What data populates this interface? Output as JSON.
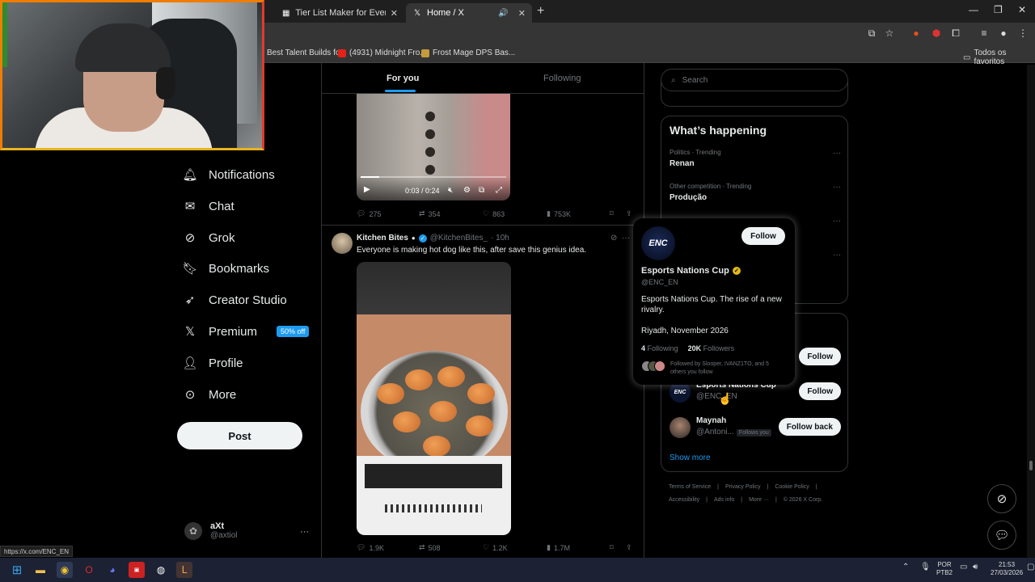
{
  "browser": {
    "tabs": [
      {
        "title": "Tier List Maker for Everything -",
        "icon": "tierlist-icon"
      },
      {
        "title": "Home / X",
        "icon": "x-logo-icon",
        "active": true
      }
    ],
    "bookmarks": [
      {
        "label": "Best Talent Builds fo...",
        "color": "#2a2a2a"
      },
      {
        "label": "(4931) Midnight Fro...",
        "color": "#e62117"
      },
      {
        "label": "Frost Mage DPS Bas...",
        "color": "#c49a3a"
      }
    ],
    "bookmarks_all": "Todos os favoritos",
    "status_url": "https://x.com/ENC_EN"
  },
  "nav": {
    "items": [
      {
        "label": "Notifications",
        "icon": "bell-icon"
      },
      {
        "label": "Chat",
        "icon": "mail-icon"
      },
      {
        "label": "Grok",
        "icon": "grok-icon"
      },
      {
        "label": "Bookmarks",
        "icon": "bookmark-icon"
      },
      {
        "label": "Creator Studio",
        "icon": "rocket-icon"
      },
      {
        "label": "Premium",
        "icon": "x-logo-icon",
        "badge": "50% off"
      },
      {
        "label": "Profile",
        "icon": "person-icon"
      },
      {
        "label": "More",
        "icon": "more-circle-icon"
      }
    ],
    "post_label": "Post",
    "account": {
      "name": "aXt",
      "handle": "@axtiol"
    }
  },
  "timeline": {
    "tabs": [
      "For you",
      "Following"
    ],
    "video1": {
      "time": "0:03 / 0:24",
      "progress": 0.125
    },
    "tweet1_stats": {
      "replies": "275",
      "reposts": "354",
      "likes": "863",
      "views": "753K"
    },
    "tweet2": {
      "name": "Kitchen Bites",
      "handle": "@KitchenBites_",
      "time": "· 10h",
      "text": "Everyone is making hot dog like this, after save this genius idea."
    },
    "tweet2_stats": {
      "replies": "1.9K",
      "reposts": "508",
      "likes": "1.2K",
      "views": "1.7M"
    }
  },
  "search": {
    "placeholder": "Search"
  },
  "trending": {
    "title": "What’s happening",
    "items": [
      {
        "meta": "Politics · Trending",
        "name": "Renan"
      },
      {
        "meta": "Other competition · Trending",
        "name": "Produção"
      }
    ]
  },
  "who_to_follow": [
    {
      "name": "Esports Nations Cup",
      "handle": "@ENC_EN",
      "button": "Follow"
    },
    {
      "name": "Maynah",
      "handle": "@Antoni...",
      "follows_you": "Follows you",
      "button": "Follow back"
    }
  ],
  "show_more": "Show more",
  "footer": {
    "row1": [
      "Terms of Service",
      "Privacy Policy",
      "Cookie Policy"
    ],
    "row2": [
      "Accessibility",
      "Ads info",
      "More ···",
      "© 2026 X Corp."
    ]
  },
  "hover_card": {
    "logo_text": "ENC",
    "follow": "Follow",
    "name": "Esports Nations Cup",
    "handle": "@ENC_EN",
    "bio": "Esports Nations Cup. The rise of a new rivalry.",
    "location": "Riyadh, November 2026",
    "following_count": "4",
    "following_label": "Following",
    "followers_count": "20K",
    "followers_label": "Followers",
    "followed_by": "Followed by Slooper, IVANZ1TO, and 5 others you follow"
  },
  "taskbar": {
    "lang": "POR",
    "layout": "PTB2",
    "time": "21:53",
    "date": "27/03/2026"
  }
}
